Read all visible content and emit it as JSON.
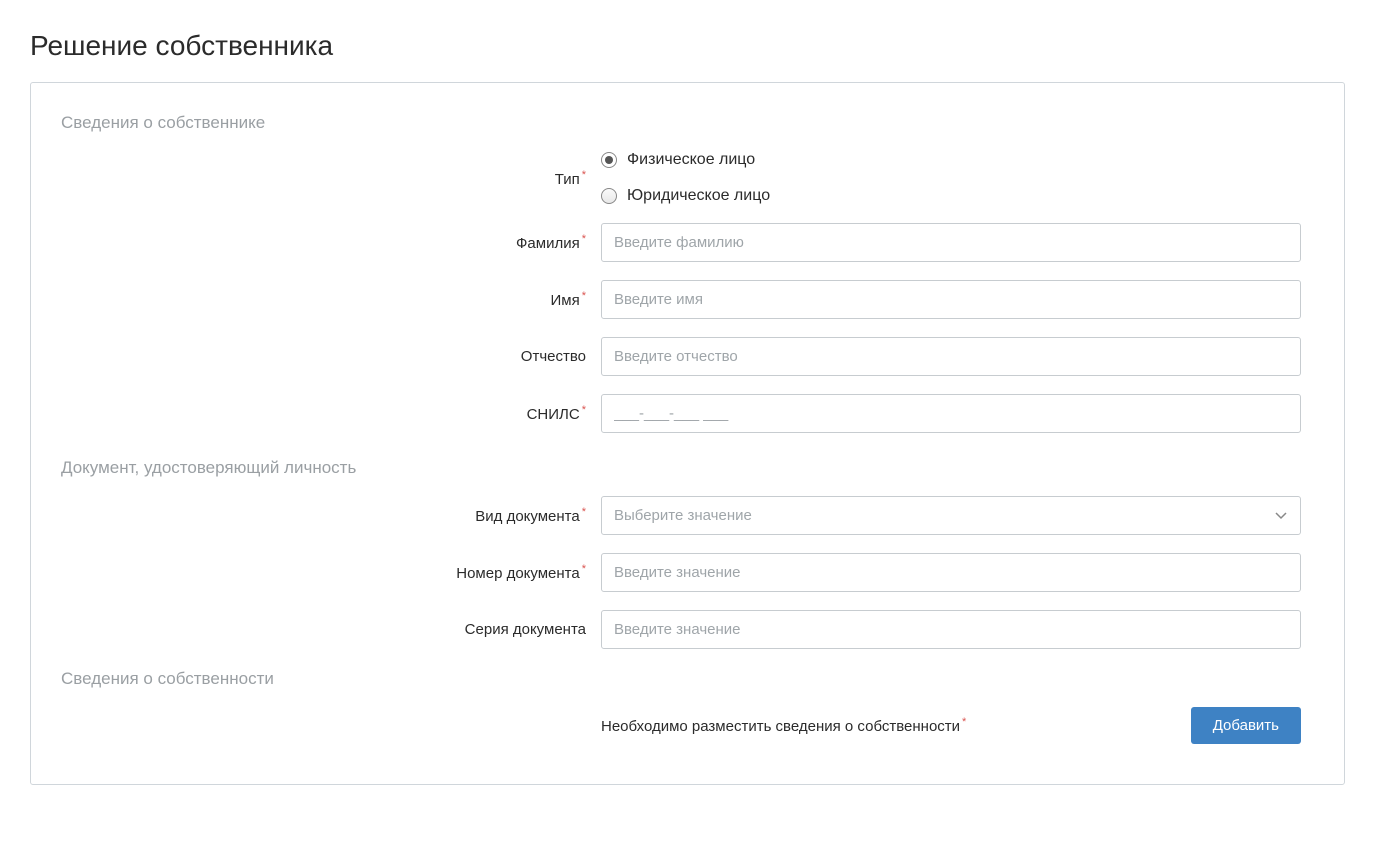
{
  "page": {
    "title": "Решение собственника"
  },
  "sections": {
    "owner_info": {
      "heading": "Сведения о собственнике",
      "type": {
        "label": "Тип",
        "options": {
          "individual": "Физическое лицо",
          "legal": "Юридическое лицо"
        },
        "selected": "individual"
      },
      "surname": {
        "label": "Фамилия",
        "placeholder": "Введите фамилию",
        "value": ""
      },
      "firstname": {
        "label": "Имя",
        "placeholder": "Введите имя",
        "value": ""
      },
      "patronymic": {
        "label": "Отчество",
        "placeholder": "Введите отчество",
        "value": ""
      },
      "snils": {
        "label": "СНИЛС",
        "placeholder": "___-___-___ ___",
        "value": ""
      }
    },
    "identity_doc": {
      "heading": "Документ, удостоверяющий личность",
      "doc_type": {
        "label": "Вид документа",
        "placeholder": "Выберите значение",
        "value": ""
      },
      "doc_number": {
        "label": "Номер документа",
        "placeholder": "Введите значение",
        "value": ""
      },
      "doc_series": {
        "label": "Серия документа",
        "placeholder": "Введите значение",
        "value": ""
      }
    },
    "ownership": {
      "heading": "Сведения о собственности",
      "message": "Необходимо разместить сведения о собственности",
      "add_button": "Добавить"
    }
  }
}
